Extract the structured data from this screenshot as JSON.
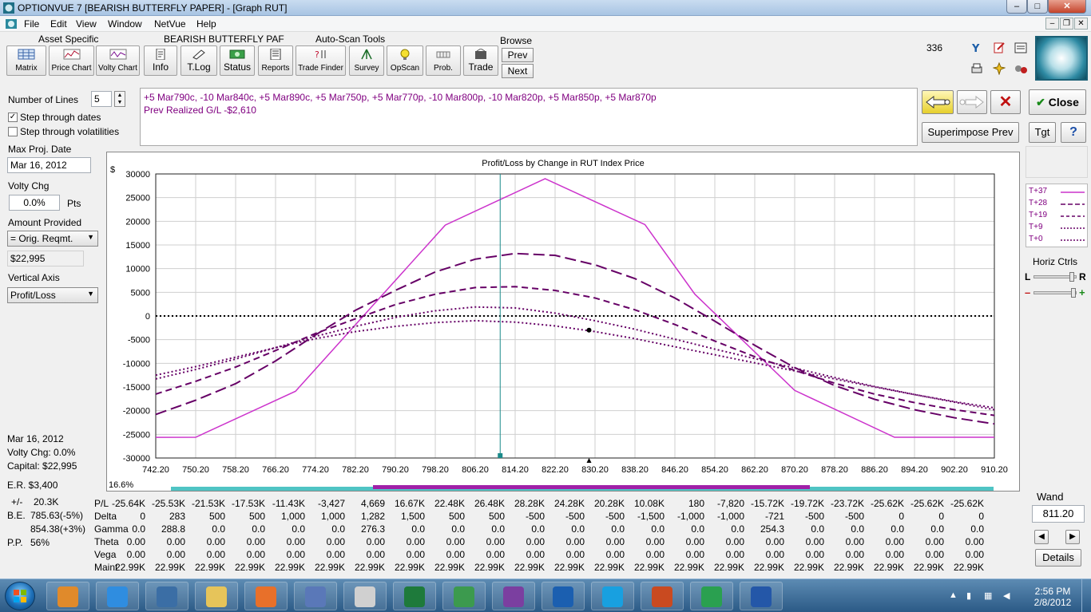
{
  "window": {
    "title": "OPTIONVUE 7   [BEARISH BUTTERFLY PAPER] - [Graph RUT]"
  },
  "menu": [
    "File",
    "Edit",
    "View",
    "Window",
    "NetVue",
    "Help"
  ],
  "toolbar": {
    "groups": {
      "asset_specific": "Asset Specific",
      "position_name": "BEARISH BUTTERFLY PAF",
      "auto_scan": "Auto-Scan Tools",
      "browse": "Browse"
    },
    "buttons": [
      "Matrix",
      "Price Chart",
      "Volty Chart",
      "Info",
      "T.Log",
      "Status",
      "Reports",
      "Trade Finder",
      "Survey",
      "OpScan",
      "Prob.",
      "Trade"
    ],
    "browse_prev": "Prev",
    "browse_next": "Next",
    "count": "336"
  },
  "left_panel": {
    "number_of_lines_label": "Number of Lines",
    "number_of_lines_value": "5",
    "step_dates_label": "Step through dates",
    "step_dates_checked": "✓",
    "step_volatilities_label": "Step through volatilities",
    "max_proj_date_label": "Max Proj. Date",
    "max_proj_date_value": "Mar 16, 2012",
    "volty_chg_label": "Volty Chg",
    "volty_chg_value": "0.0%",
    "volty_chg_unit": "Pts",
    "amount_provided_label": "Amount Provided",
    "amount_provided_select": "= Orig. Reqmt.",
    "amount_value": "$22,995",
    "vertical_axis_label": "Vertical Axis",
    "vertical_axis_select": "Profit/Loss"
  },
  "position": {
    "legs": "+5 Mar790c, -10 Mar840c, +5 Mar890c, +5 Mar750p, +5 Mar770p, -10 Mar800p, -10 Mar820p, +5 Mar850p, +5 Mar870p",
    "prev_realized": "Prev Realized G/L -$2,610"
  },
  "right_buttons": {
    "close": "Close",
    "superimpose": "Superimpose Prev",
    "tgt": "Tgt",
    "help": "?"
  },
  "chart_data": {
    "type": "line",
    "title": "Profit/Loss by Change in RUT Index Price",
    "ylabel": "$",
    "xlabel": "",
    "x_ticks": [
      742.2,
      750.2,
      758.2,
      766.2,
      774.2,
      782.2,
      790.2,
      798.2,
      806.2,
      814.2,
      822.2,
      830.2,
      838.2,
      846.2,
      854.2,
      862.2,
      870.2,
      878.2,
      886.2,
      894.2,
      902.2,
      910.2
    ],
    "y_ticks": [
      30000,
      25000,
      20000,
      15000,
      10000,
      5000,
      0,
      -5000,
      -10000,
      -15000,
      -20000,
      -25000,
      -30000
    ],
    "xlim": [
      742.2,
      910.2
    ],
    "ylim": [
      -30000,
      30000
    ],
    "grid": true,
    "cursor_x": 811.2,
    "current_price_marker": 829.0,
    "current_point": {
      "x": 829.0,
      "y": -3000
    },
    "series": [
      {
        "name": "T+37",
        "style": "solid",
        "color": "#cc33cc",
        "x": [
          742.2,
          750.2,
          770.2,
          800.2,
          820.2,
          840.2,
          850.2,
          870.2,
          890.2,
          910.2
        ],
        "y": [
          -25640,
          -25620,
          -15900,
          19200,
          29000,
          19300,
          4600,
          -15720,
          -25620,
          -25620
        ]
      },
      {
        "name": "T+28",
        "style": "longdash",
        "color": "#660066",
        "x": [
          742.2,
          750.2,
          758.2,
          766.2,
          774.2,
          782.2,
          790.2,
          798.2,
          806.2,
          814.2,
          822.2,
          830.2,
          838.2,
          846.2,
          854.2,
          862.2,
          870.2,
          878.2,
          886.2,
          894.2,
          902.2,
          910.2
        ],
        "y": [
          -20800,
          -17800,
          -14300,
          -9500,
          -4000,
          1200,
          5400,
          9300,
          12000,
          13200,
          12800,
          10800,
          7900,
          3800,
          -1100,
          -6200,
          -10900,
          -14700,
          -17600,
          -19800,
          -21500,
          -22800
        ]
      },
      {
        "name": "T+19",
        "style": "dash",
        "color": "#660066",
        "x": [
          742.2,
          750.2,
          758.2,
          766.2,
          774.2,
          782.2,
          790.2,
          798.2,
          806.2,
          814.2,
          822.2,
          830.2,
          838.2,
          846.2,
          854.2,
          862.2,
          870.2,
          878.2,
          886.2,
          894.2,
          902.2,
          910.2
        ],
        "y": [
          -16500,
          -13800,
          -10800,
          -7300,
          -3700,
          -600,
          2400,
          4600,
          6000,
          6200,
          5400,
          3800,
          1300,
          -1800,
          -5300,
          -8600,
          -11500,
          -14200,
          -16500,
          -18300,
          -19800,
          -21000
        ]
      },
      {
        "name": "T+9",
        "style": "dot",
        "color": "#660066",
        "x": [
          742.2,
          750.2,
          758.2,
          766.2,
          774.2,
          782.2,
          790.2,
          798.2,
          806.2,
          814.2,
          822.2,
          830.2,
          838.2,
          846.2,
          854.2,
          862.2,
          870.2,
          878.2,
          886.2,
          894.2,
          902.2,
          910.2
        ],
        "y": [
          -13300,
          -11300,
          -9100,
          -6700,
          -4300,
          -2200,
          -300,
          1100,
          1900,
          1700,
          600,
          -1000,
          -2800,
          -4900,
          -7000,
          -9000,
          -11000,
          -13000,
          -14900,
          -16600,
          -18100,
          -19400
        ]
      },
      {
        "name": "T+0",
        "style": "dot",
        "color": "#660066",
        "x": [
          742.2,
          750.2,
          758.2,
          766.2,
          774.2,
          782.2,
          790.2,
          798.2,
          806.2,
          814.2,
          822.2,
          830.2,
          838.2,
          846.2,
          854.2,
          862.2,
          870.2,
          878.2,
          886.2,
          894.2,
          902.2,
          910.2
        ],
        "y": [
          -12500,
          -10700,
          -8700,
          -6700,
          -4800,
          -3300,
          -2200,
          -1400,
          -1000,
          -1300,
          -2100,
          -3300,
          -4800,
          -6500,
          -8200,
          -9900,
          -11600,
          -13300,
          -15000,
          -16600,
          -18200,
          -19800
        ]
      }
    ],
    "legend": [
      "T+37",
      "T+28",
      "T+19",
      "T+9",
      "T+0"
    ],
    "legend_placement": "right"
  },
  "chart_footer": {
    "pct": "16.6%"
  },
  "horiz_ctrls": {
    "label": "Horiz Ctrls",
    "l": "L",
    "r": "R",
    "minus": "–",
    "plus": "+"
  },
  "info": {
    "date": "Mar 16, 2012",
    "volty": "Volty Chg:  0.0%",
    "capital": "Capital:  $22,995",
    "er": "E.R. $3,400"
  },
  "stats": {
    "pm_label": "+/-",
    "pm_value": "20.3K",
    "be_label": "B.E.",
    "be_value1": "785.63(-5%)",
    "be_value2": "854.38(+3%)",
    "pp_label": "P.P.",
    "pp_value": "56%"
  },
  "table": {
    "rows": [
      {
        "label": "P/L",
        "values": [
          "-25.64K",
          "-25.53K",
          "-21.53K",
          "-17.53K",
          "-11.43K",
          "-3,427",
          "4,669",
          "16.67K",
          "22.48K",
          "26.48K",
          "28.28K",
          "24.28K",
          "20.28K",
          "10.08K",
          "180",
          "-7,820",
          "-15.72K",
          "-19.72K",
          "-23.72K",
          "-25.62K",
          "-25.62K",
          "-25.62K"
        ]
      },
      {
        "label": "Delta",
        "values": [
          "0",
          "283",
          "500",
          "500",
          "1,000",
          "1,000",
          "1,282",
          "1,500",
          "500",
          "500",
          "-500",
          "-500",
          "-500",
          "-1,500",
          "-1,000",
          "-1,000",
          "-721",
          "-500",
          "-500",
          "0",
          "0",
          "0"
        ]
      },
      {
        "label": "Gamma",
        "values": [
          "0.0",
          "288.8",
          "0.0",
          "0.0",
          "0.0",
          "0.0",
          "276.3",
          "0.0",
          "0.0",
          "0.0",
          "0.0",
          "0.0",
          "0.0",
          "0.0",
          "0.0",
          "0.0",
          "254.3",
          "0.0",
          "0.0",
          "0.0",
          "0.0",
          "0.0"
        ]
      },
      {
        "label": "Theta",
        "values": [
          "0.00",
          "0.00",
          "0.00",
          "0.00",
          "0.00",
          "0.00",
          "0.00",
          "0.00",
          "0.00",
          "0.00",
          "0.00",
          "0.00",
          "0.00",
          "0.00",
          "0.00",
          "0.00",
          "0.00",
          "0.00",
          "0.00",
          "0.00",
          "0.00",
          "0.00"
        ]
      },
      {
        "label": "Vega",
        "values": [
          "0.00",
          "0.00",
          "0.00",
          "0.00",
          "0.00",
          "0.00",
          "0.00",
          "0.00",
          "0.00",
          "0.00",
          "0.00",
          "0.00",
          "0.00",
          "0.00",
          "0.00",
          "0.00",
          "0.00",
          "0.00",
          "0.00",
          "0.00",
          "0.00",
          "0.00"
        ]
      },
      {
        "label": "Maint",
        "values": [
          "22.99K",
          "22.99K",
          "22.99K",
          "22.99K",
          "22.99K",
          "22.99K",
          "22.99K",
          "22.99K",
          "22.99K",
          "22.99K",
          "22.99K",
          "22.99K",
          "22.99K",
          "22.99K",
          "22.99K",
          "22.99K",
          "22.99K",
          "22.99K",
          "22.99K",
          "22.99K",
          "22.99K",
          "22.99K"
        ]
      }
    ]
  },
  "wand": {
    "label": "Wand",
    "value": "811.20",
    "details": "Details",
    "left": "◀",
    "right": "▶"
  },
  "taskbar": {
    "time": "2:56 PM",
    "date": "2/8/2012",
    "apps": [
      "media-player",
      "internet-explorer",
      "4gwimax",
      "file-explorer",
      "firefox",
      "shield",
      "calculator",
      "excel",
      "network",
      "onenote",
      "outlook",
      "skype",
      "powerpoint",
      "optionvue",
      "word"
    ],
    "app_colors": [
      "#e08a2b",
      "#2f8de0",
      "#3b6ea5",
      "#e6c45a",
      "#e8702a",
      "#5a78b8",
      "#d0d0d0",
      "#1e7a3b",
      "#3c9a4e",
      "#7b3fa0",
      "#1b5fb0",
      "#18a0e0",
      "#c94a20",
      "#2aa050",
      "#2457a8"
    ]
  }
}
